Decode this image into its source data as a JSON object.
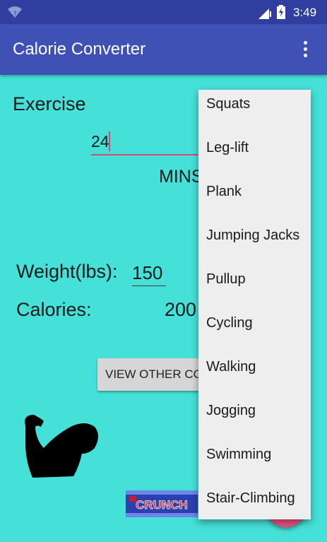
{
  "status_bar": {
    "time": "3:49",
    "icons": [
      "wifi-icon",
      "signal-icon",
      "battery-charging-icon"
    ]
  },
  "app_bar": {
    "title": "Calorie Converter",
    "overflow_icon": "more-vert-icon",
    "color": "#3f51b5"
  },
  "exercise": {
    "label": "Exercise",
    "minutes_value": "24",
    "units_label": "MINS"
  },
  "weight": {
    "label": "Weight(lbs):",
    "value": "150"
  },
  "calories": {
    "label": "Calories:",
    "value": "200"
  },
  "view_other_button": {
    "label": "VIEW OTHER CO"
  },
  "images": {
    "muscle": "flexed-bicep-icon",
    "crunch_label": "CRUNCH"
  },
  "menu": {
    "items": [
      {
        "label": "Squats"
      },
      {
        "label": "Leg-lift"
      },
      {
        "label": "Plank"
      },
      {
        "label": "Jumping Jacks"
      },
      {
        "label": "Pullup"
      },
      {
        "label": "Cycling"
      },
      {
        "label": "Walking"
      },
      {
        "label": "Jogging"
      },
      {
        "label": "Swimming"
      },
      {
        "label": "Stair-Climbing"
      }
    ]
  },
  "colors": {
    "background": "#45e0d8",
    "accent": "#e0457b",
    "status_bar": "#303f9f"
  }
}
